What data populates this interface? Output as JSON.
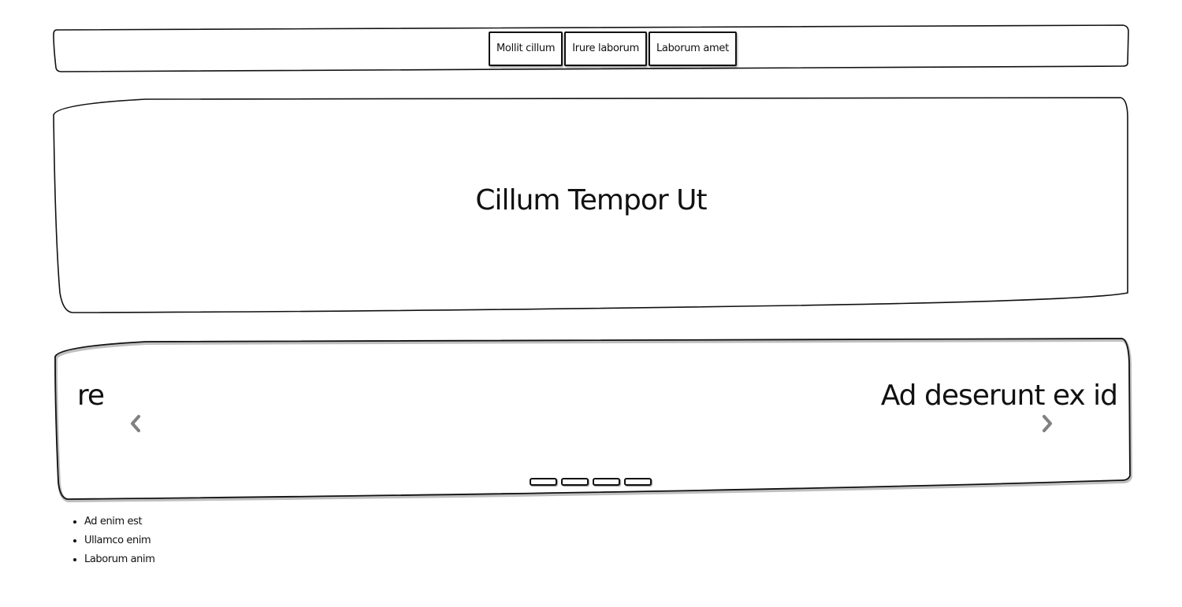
{
  "nav": {
    "items": [
      {
        "label": "Mollit cillum"
      },
      {
        "label": "Irure laborum"
      },
      {
        "label": "Laborum amet"
      }
    ]
  },
  "hero": {
    "title": "Cillum Tempor Ut"
  },
  "carousel": {
    "previous_slide_text": "re",
    "current_slide_text": "Ad deserunt ex id",
    "prev_icon": "chevron-left-icon",
    "next_icon": "chevron-right-icon",
    "indicator_count": 4
  },
  "list": {
    "items": [
      "Ad enim est",
      "Ullamco enim",
      "Laborum anim"
    ]
  },
  "colors": {
    "ink": "#111111",
    "arrow": "#808080",
    "background": "#ffffff"
  }
}
